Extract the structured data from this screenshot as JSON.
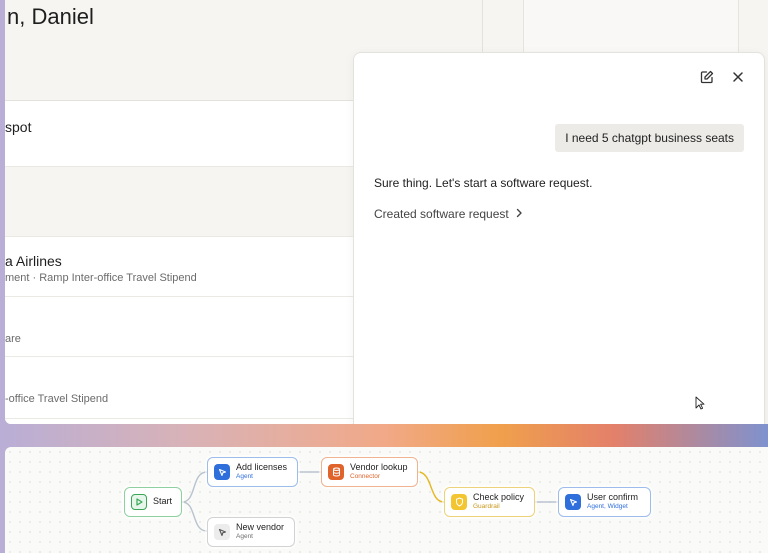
{
  "page": {
    "heading": "n, Daniel"
  },
  "list": {
    "rows": [
      {
        "title": "spot",
        "subtitle": ""
      },
      {
        "title": "",
        "subtitle": ""
      },
      {
        "title": "a Airlines",
        "subtitle": "ment · Ramp Inter-office Travel Stipend"
      },
      {
        "title": "",
        "subtitle": "are"
      },
      {
        "title": "",
        "subtitle": "-office Travel Stipend"
      }
    ]
  },
  "chat": {
    "user_message": "I need 5 chatgpt business seats",
    "assistant_message": "Sure thing. Let's start a software request.",
    "created_link": "Created software request",
    "icons": {
      "edit": "edit-icon",
      "close": "close-icon",
      "chevron": "chevron-right-icon"
    }
  },
  "workflow": {
    "nodes": {
      "start": {
        "label": "Start",
        "sub": "",
        "color": "#3aa655"
      },
      "add_licenses": {
        "label": "Add licenses",
        "sub": "Agent",
        "color": "#2f6fdc"
      },
      "new_vendor": {
        "label": "New vendor",
        "sub": "Agent",
        "color": "#6e6e6e"
      },
      "vendor_lookup": {
        "label": "Vendor lookup",
        "sub": "Connector",
        "color": "#e0632c"
      },
      "check_policy": {
        "label": "Check policy",
        "sub": "Guardrail",
        "color": "#e5b722"
      },
      "user_confirm": {
        "label": "User confirm",
        "sub": "Agent, Widget",
        "color": "#2f6fdc"
      }
    }
  }
}
